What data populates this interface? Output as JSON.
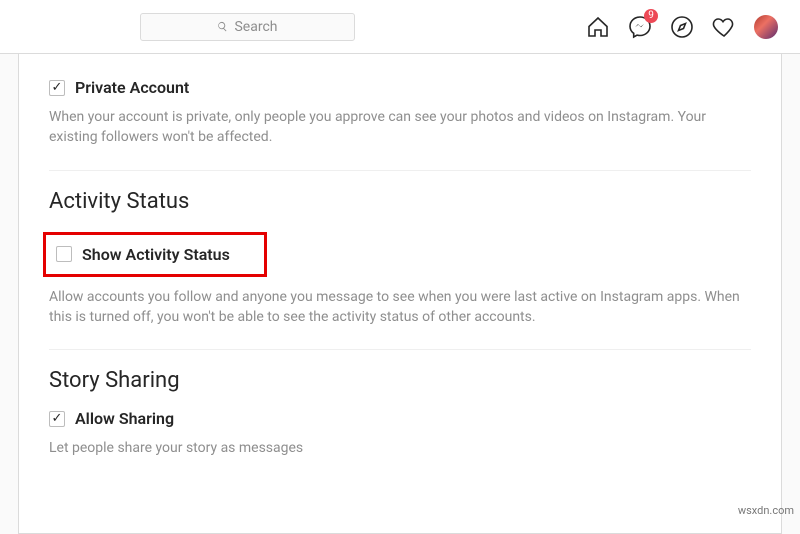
{
  "header": {
    "search_placeholder": "Search",
    "badge_count": "9"
  },
  "private": {
    "label": "Private Account",
    "desc": "When your account is private, only people you approve can see your photos and videos on Instagram. Your existing followers won't be affected."
  },
  "activity": {
    "heading": "Activity Status",
    "label": "Show Activity Status",
    "desc": "Allow accounts you follow and anyone you message to see when you were last active on Instagram apps. When this is turned off, you won't be able to see the activity status of other accounts."
  },
  "story": {
    "heading": "Story Sharing",
    "label": "Allow Sharing",
    "desc": "Let people share your story as messages"
  },
  "watermark": "wsxdn.com"
}
